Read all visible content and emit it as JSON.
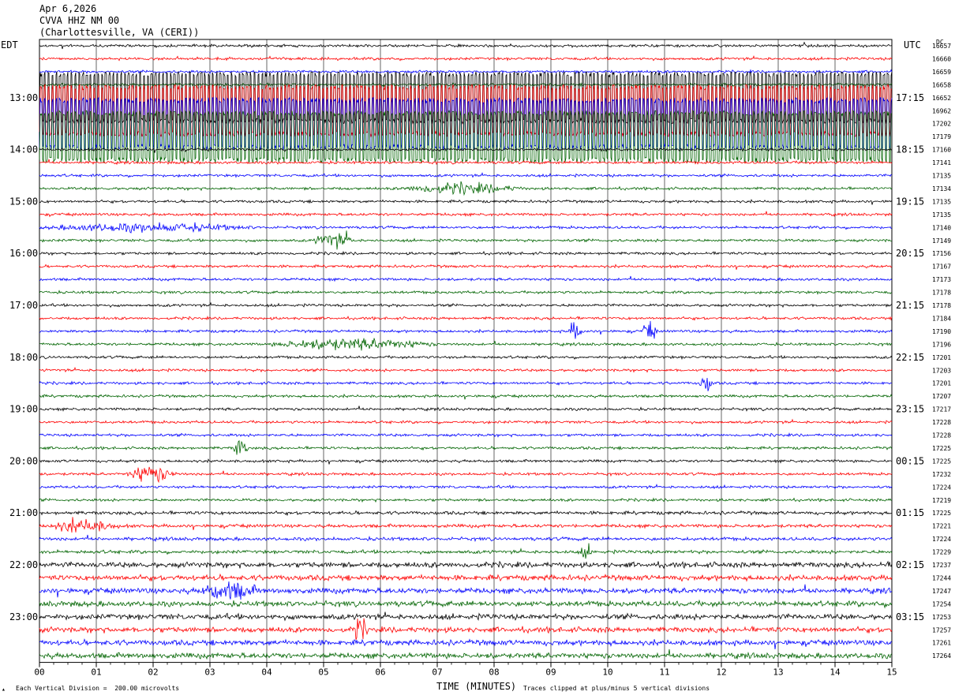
{
  "header": {
    "date": "Apr 6,2026",
    "station": "CVVA HHZ NM 00",
    "location": "(Charlottesville, VA (CERI))"
  },
  "labels": {
    "left_zone": "EDT",
    "right_zone": "UTC",
    "dc_header": "DC",
    "xlabel": "TIME (MINUTES)",
    "vertical_division": "Each Vertical Division =  200.00 microvolts",
    "clip_note": "Traces clipped at plus/minus 5 vertical divisions"
  },
  "chart_data": {
    "type": "line",
    "title": "CVVA HHZ NM 00",
    "xlabel": "TIME (MINUTES)",
    "x_ticks": [
      "00",
      "01",
      "02",
      "03",
      "04",
      "05",
      "06",
      "07",
      "08",
      "09",
      "10",
      "11",
      "12",
      "13",
      "14",
      "15"
    ],
    "xlim": [
      0,
      15
    ],
    "trace_minutes": 15,
    "trace_colors": [
      "#000000",
      "#ff0000",
      "#0000ff",
      "#006400"
    ],
    "edt_hour_labels": [
      "13:00",
      "14:00",
      "15:00",
      "16:00",
      "17:00",
      "18:00",
      "19:00",
      "20:00",
      "21:00",
      "22:00",
      "23:00"
    ],
    "utc_hour_labels": [
      "17:15",
      "18:15",
      "19:15",
      "20:15",
      "21:15",
      "22:15",
      "23:15",
      "00:15",
      "01:15",
      "02:15",
      "03:15"
    ],
    "dc_offsets": [
      16657,
      16660,
      16659,
      16658,
      16652,
      16962,
      17202,
      17179,
      17160,
      17141,
      17135,
      17134,
      17135,
      17135,
      17140,
      17149,
      17156,
      17167,
      17173,
      17178,
      17178,
      17184,
      17190,
      17196,
      17201,
      17203,
      17201,
      17207,
      17217,
      17228,
      17228,
      17225,
      17225,
      17232,
      17224,
      17219,
      17225,
      17221,
      17224,
      17229,
      17237,
      17244,
      17247,
      17254,
      17253,
      17257,
      17261,
      17264
    ],
    "clipped_rows": [
      4,
      5,
      6,
      7
    ],
    "events": [
      {
        "row": 14,
        "start_min": 0.0,
        "end_min": 7.0,
        "amp": 1.6
      },
      {
        "row": 15,
        "start_min": 4.8,
        "end_min": 6.2,
        "amp": 3.0
      },
      {
        "row": 11,
        "start_min": 6.3,
        "end_min": 10.4,
        "amp": 2.0
      },
      {
        "row": 23,
        "start_min": 4.0,
        "end_min": 9.5,
        "amp": 2.2
      },
      {
        "row": 22,
        "start_min": 9.3,
        "end_min": 9.8,
        "amp": 4.0
      },
      {
        "row": 22,
        "start_min": 10.6,
        "end_min": 11.1,
        "amp": 4.0
      },
      {
        "row": 26,
        "start_min": 11.6,
        "end_min": 12.1,
        "amp": 3.5
      },
      {
        "row": 31,
        "start_min": 3.4,
        "end_min": 3.9,
        "amp": 4.5
      },
      {
        "row": 33,
        "start_min": 1.5,
        "end_min": 3.2,
        "amp": 3.5
      },
      {
        "row": 37,
        "start_min": 0.1,
        "end_min": 2.5,
        "amp": 2.5
      },
      {
        "row": 42,
        "start_min": 2.8,
        "end_min": 4.8,
        "amp": 3.5
      },
      {
        "row": 45,
        "start_min": 5.5,
        "end_min": 6.0,
        "amp": 4.5
      },
      {
        "row": 39,
        "start_min": 9.5,
        "end_min": 10.0,
        "amp": 2.5
      }
    ]
  }
}
